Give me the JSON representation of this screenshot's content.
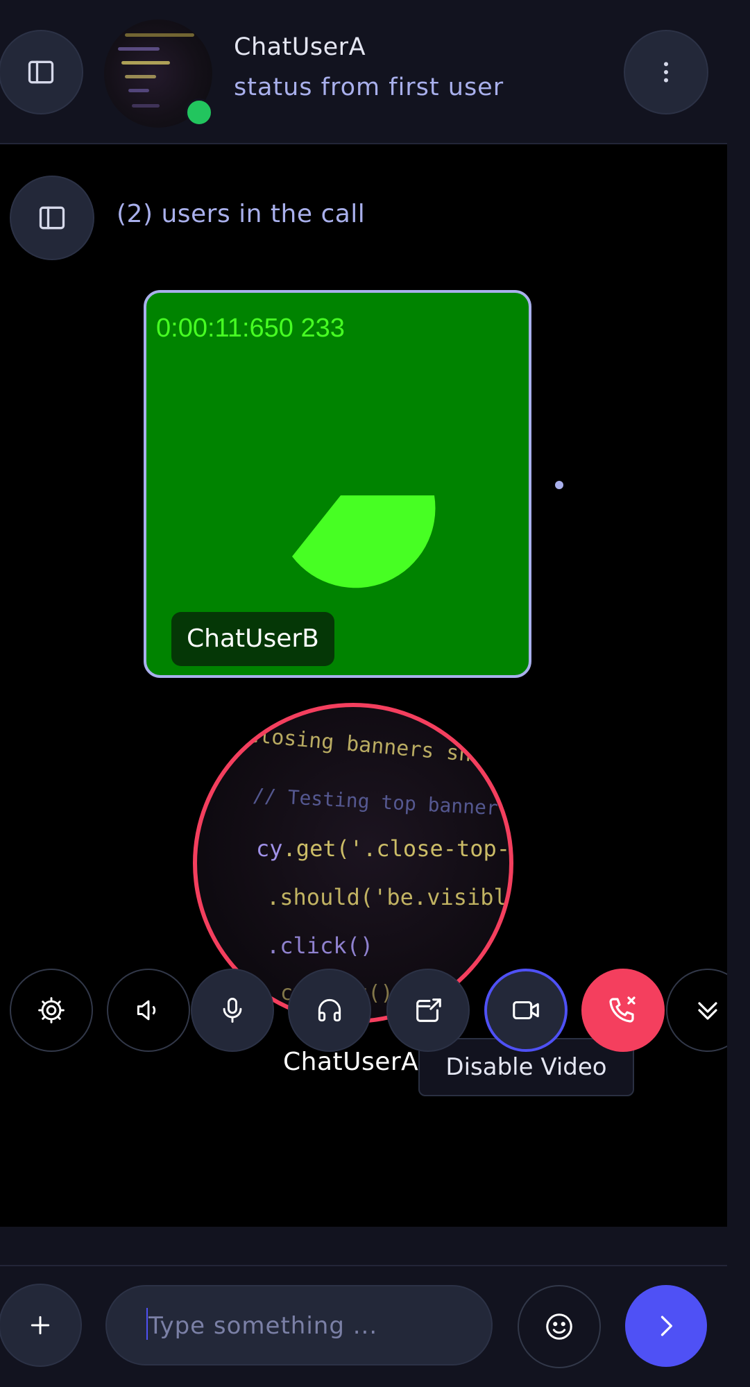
{
  "header": {
    "user_name": "ChatUserA",
    "status": "status from first user",
    "online_color": "#22c55e"
  },
  "call": {
    "users_label": "(2) users in the call",
    "remote": {
      "timer": "0:00:11:650 233",
      "name": "ChatUserB"
    },
    "local": {
      "name": "ChatUserA"
    },
    "tooltip": "Disable Video",
    "controls": [
      {
        "name": "settings",
        "icon": "gear-icon"
      },
      {
        "name": "speaker",
        "icon": "speaker-icon"
      },
      {
        "name": "microphone",
        "icon": "microphone-icon"
      },
      {
        "name": "headphones",
        "icon": "headphones-icon"
      },
      {
        "name": "screen-share",
        "icon": "window-share-icon"
      },
      {
        "name": "video",
        "icon": "video-camera-icon",
        "state": "active"
      },
      {
        "name": "end-call",
        "icon": "phone-hangup-icon"
      },
      {
        "name": "collapse",
        "icon": "chevron-double-down-icon"
      }
    ]
  },
  "composer": {
    "placeholder": "Type something ...",
    "value": ""
  },
  "colors": {
    "accent": "#4f51f5",
    "danger": "#f43f5e",
    "tile_bg": "#008300",
    "timer": "#47ff23",
    "muted_text": "#a9b0ec"
  }
}
